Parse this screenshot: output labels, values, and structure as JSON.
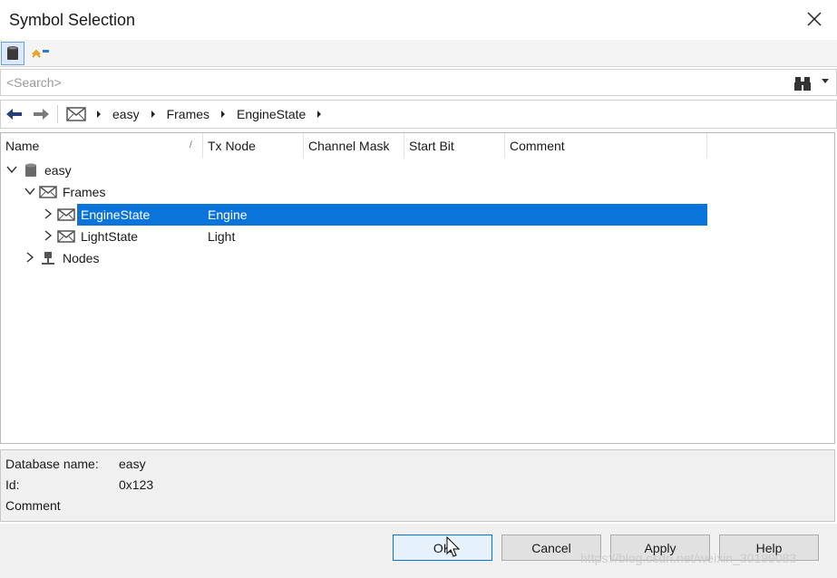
{
  "window": {
    "title": "Symbol Selection"
  },
  "search": {
    "placeholder": "<Search>"
  },
  "breadcrumb": [
    "easy",
    "Frames",
    "EngineState"
  ],
  "columns": {
    "name": "Name",
    "tx_node": "Tx Node",
    "channel_mask": "Channel Mask",
    "start_bit": "Start Bit",
    "comment": "Comment"
  },
  "tree": {
    "root": {
      "label": "easy"
    },
    "frames": {
      "label": "Frames"
    },
    "engine": {
      "label": "EngineState",
      "tx_node": "Engine",
      "selected": true
    },
    "light": {
      "label": "LightState",
      "tx_node": "Light"
    },
    "nodes": {
      "label": "Nodes"
    }
  },
  "info": {
    "db_label": "Database name:",
    "db_value": "easy",
    "id_label": "Id:",
    "id_value": "0x123",
    "comment_label": "Comment"
  },
  "buttons": {
    "ok": "OK",
    "cancel": "Cancel",
    "apply": "Apply",
    "help": "Help"
  },
  "watermark": "https://blog.csdn.net/weixin_30199083",
  "colors": {
    "selection": "#0a74da",
    "ok_border": "#0078d7"
  },
  "icons": [
    "close-icon",
    "database-icon",
    "symbol-icon",
    "binoculars-icon",
    "back-arrow-icon",
    "forward-arrow-icon",
    "envelope-icon",
    "node-icon",
    "chevron-icon"
  ]
}
